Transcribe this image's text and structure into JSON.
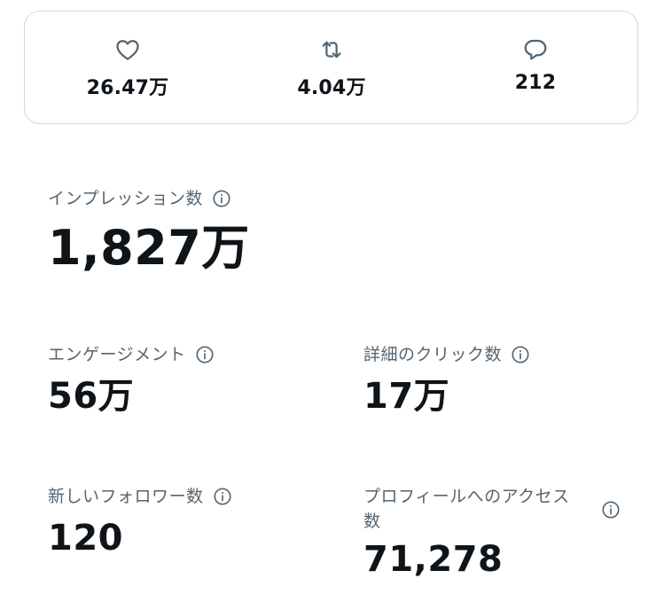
{
  "engagement_bar": {
    "likes": {
      "icon": "heart-icon",
      "count": "26.47万"
    },
    "reposts": {
      "icon": "repost-icon",
      "count": "4.04万"
    },
    "replies": {
      "icon": "reply-icon",
      "count": "212"
    }
  },
  "metrics": {
    "impressions": {
      "label": "インプレッション数",
      "value": "1,827万",
      "info_icon": "info-icon"
    },
    "engagements": {
      "label": "エンゲージメント",
      "value": "56万",
      "info_icon": "info-icon"
    },
    "detail_clicks": {
      "label": "詳細のクリック数",
      "value": "17万",
      "info_icon": "info-icon"
    },
    "new_followers": {
      "label": "新しいフォロワー数",
      "value": "120",
      "info_icon": "info-icon"
    },
    "profile_visits": {
      "label": "プロフィールへのアクセス数",
      "value": "71,278",
      "info_icon": "info-icon"
    }
  },
  "colors": {
    "text_primary": "#0f1419",
    "text_secondary": "#536471",
    "border": "#cfd9de",
    "background": "#ffffff"
  }
}
